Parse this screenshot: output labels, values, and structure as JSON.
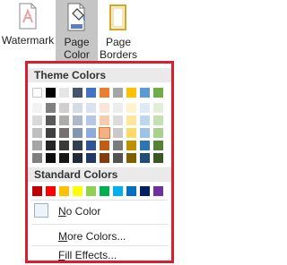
{
  "ribbon": {
    "watermark_label": "Watermark",
    "page_color_label_1": "Page",
    "page_color_label_2": "Color",
    "page_borders_label_1": "Page",
    "page_borders_label_2": "Borders"
  },
  "dropdown": {
    "theme_colors_title": "Theme Colors",
    "standard_colors_title": "Standard Colors",
    "theme_top_row": [
      "#ffffff",
      "#000000",
      "#e7e6e6",
      "#44546a",
      "#4472c4",
      "#ed7d31",
      "#a5a5a5",
      "#ffc000",
      "#5b9bd5",
      "#70ad47"
    ],
    "theme_shades": [
      [
        "#f2f2f2",
        "#7f7f7f",
        "#d0cece",
        "#d6dce5",
        "#d9e2f3",
        "#fbe5d6",
        "#ededed",
        "#fff2cc",
        "#deebf7",
        "#e2f0d9"
      ],
      [
        "#d9d9d9",
        "#595959",
        "#aeabab",
        "#adb9ca",
        "#b4c7e7",
        "#f8cbad",
        "#dbdbdb",
        "#ffe699",
        "#bdd7ee",
        "#c5e0b4"
      ],
      [
        "#bfbfbf",
        "#404040",
        "#757171",
        "#8497b0",
        "#8faadc",
        "#f4b183",
        "#c9c9c9",
        "#ffd966",
        "#9dc3e6",
        "#a9d18e"
      ],
      [
        "#a6a6a6",
        "#262626",
        "#3b3838",
        "#323f4f",
        "#2f5597",
        "#c55a11",
        "#7b7b7b",
        "#bf9000",
        "#2e75b6",
        "#548235"
      ],
      [
        "#7f7f7f",
        "#0d0d0d",
        "#171616",
        "#222a35",
        "#203864",
        "#843c0c",
        "#525252",
        "#7f6000",
        "#1f4e79",
        "#385723"
      ]
    ],
    "standard_colors": [
      "#c00000",
      "#ff0000",
      "#ffc000",
      "#ffff00",
      "#92d050",
      "#00b050",
      "#00b0f0",
      "#0070c0",
      "#002060",
      "#7030a0"
    ],
    "selected_swatch": "theme-shade-2-5",
    "no_color_label": "No Color",
    "more_colors_label": "More Colors...",
    "fill_effects_label": "Fill Effects..."
  }
}
